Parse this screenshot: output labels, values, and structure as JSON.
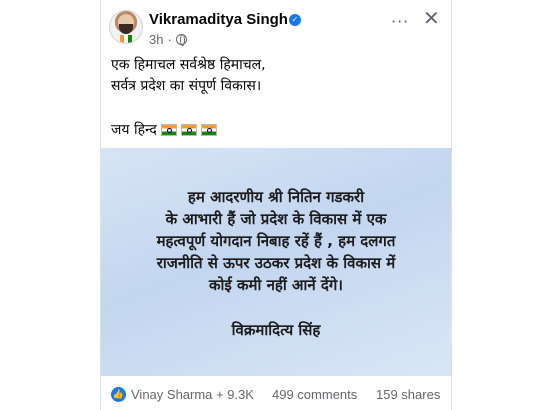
{
  "post": {
    "author": "Vikramaditya Singh",
    "time": "3h",
    "more": "···",
    "close": "✕",
    "lines": [
      "एक हिमाचल सर्वश्रेष्ठ हिमाचल,",
      "सर्वत्र प्रदेश का संपूर्ण विकास।"
    ],
    "jai_hind": "जय हिन्द",
    "image": {
      "message_lines": [
        "हम आदरणीय श्री नितिन गडकरी",
        "के आभारी हैं जो प्रदेश के विकास में एक",
        "महत्वपूर्ण योगदान निबाह रहें हैं , हम दलगत",
        "राजनीति से ऊपर उठकर प्रदेश के विकास में",
        "कोई कमी नहीं आनें देंगे।"
      ],
      "signature": "विक्रमादित्य सिंह"
    },
    "footer": {
      "reactions": "Vinay Sharma + 9.3K",
      "comments": "499 comments",
      "shares": "159 shares"
    }
  },
  "icons": {
    "verified": "verified-badge-icon",
    "globe": "globe-icon",
    "like": "like-icon"
  },
  "colors": {
    "accent": "#1877f2",
    "image_bg": "#c3d6f0"
  }
}
